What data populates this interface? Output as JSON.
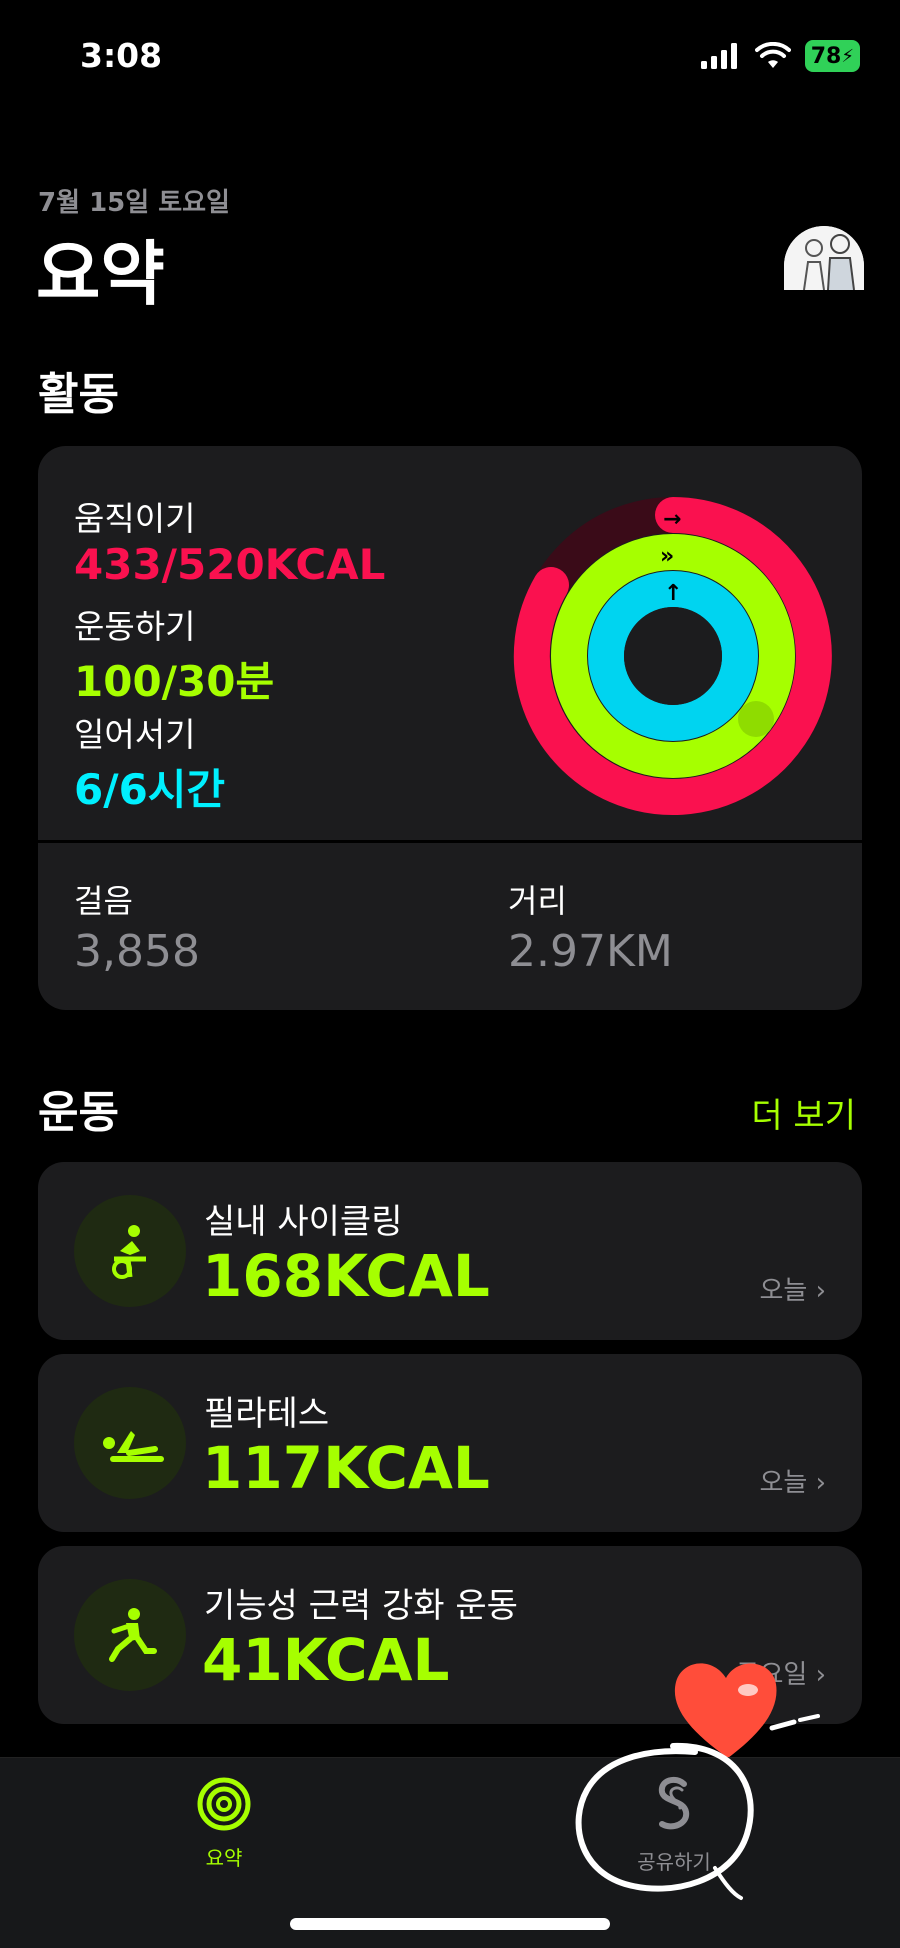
{
  "status_bar": {
    "time": "3:08",
    "battery": "78"
  },
  "header": {
    "date": "7월 15일 토요일",
    "title": "요약"
  },
  "activity": {
    "section_title": "활동",
    "move": {
      "label": "움직이기",
      "value": "433/520KCAL",
      "progress": 0.833,
      "color": "#fa114f"
    },
    "exercise": {
      "label": "운동하기",
      "value": "100/30분",
      "progress": 3.33,
      "color": "#a6ff00"
    },
    "stand": {
      "label": "일어서기",
      "value": "6/6시간",
      "progress": 1.0,
      "color": "#00f0ff"
    },
    "steps": {
      "label": "걸음",
      "value": "3,858"
    },
    "distance": {
      "label": "거리",
      "value": "2.97KM"
    }
  },
  "workouts": {
    "section_title": "운동",
    "see_more": "더 보기",
    "items": [
      {
        "name": "실내 사이클링",
        "kcal": "168KCAL",
        "date": "오늘 ›",
        "icon": "cycling-icon"
      },
      {
        "name": "필라테스",
        "kcal": "117KCAL",
        "date": "오늘 ›",
        "icon": "pilates-icon"
      },
      {
        "name": "기능성 근력 강화 운동",
        "kcal": "41KCAL",
        "date": "금요일 ›",
        "icon": "strength-icon"
      }
    ]
  },
  "tabbar": {
    "summary": {
      "label": "요약",
      "color": "#a6ff00"
    },
    "sharing": {
      "label": "공유하기",
      "color": "#8e8e93"
    }
  }
}
